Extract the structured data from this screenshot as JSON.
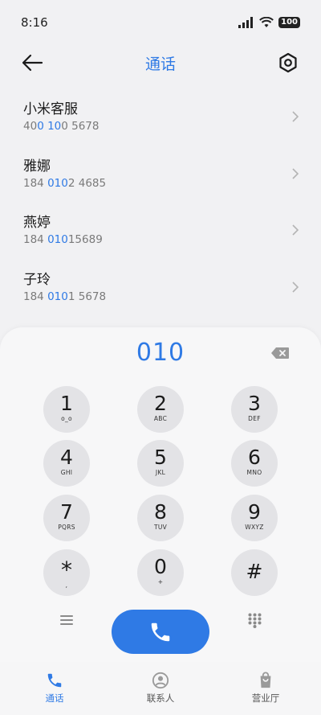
{
  "status_bar": {
    "time": "8:16",
    "battery": "100"
  },
  "header": {
    "title": "通话"
  },
  "contacts": [
    {
      "name": "小米客服",
      "number_pre": "40",
      "number_match": "0 10",
      "number_post": "0 5678"
    },
    {
      "name": "雅娜",
      "number_pre": "184 ",
      "number_match": "010",
      "number_post": "2 4685"
    },
    {
      "name": "燕婷",
      "number_pre": "184 ",
      "number_match": "010",
      "number_post": "15689"
    },
    {
      "name": "子玲",
      "number_pre": "184 ",
      "number_match": "010",
      "number_post": "1 5678"
    }
  ],
  "dialer": {
    "input_value": "010",
    "keys": [
      {
        "digit": "1",
        "letters": "o_o"
      },
      {
        "digit": "2",
        "letters": "ABC"
      },
      {
        "digit": "3",
        "letters": "DEF"
      },
      {
        "digit": "4",
        "letters": "GHI"
      },
      {
        "digit": "5",
        "letters": "JKL"
      },
      {
        "digit": "6",
        "letters": "MNO"
      },
      {
        "digit": "7",
        "letters": "PQRS"
      },
      {
        "digit": "8",
        "letters": "TUV"
      },
      {
        "digit": "9",
        "letters": "WXYZ"
      },
      {
        "digit": "*",
        "letters": ","
      },
      {
        "digit": "0",
        "letters": "+"
      },
      {
        "digit": "#",
        "letters": ""
      }
    ]
  },
  "bottom_nav": {
    "items": [
      {
        "label": "通话",
        "icon": "phone-icon",
        "active": true
      },
      {
        "label": "联系人",
        "icon": "person-icon",
        "active": false
      },
      {
        "label": "营业厅",
        "icon": "shopping-bag-icon",
        "active": false
      }
    ]
  },
  "colors": {
    "accent": "#2f7ae5",
    "key_bg": "#e3e3e6",
    "background": "#f1f1f3"
  }
}
